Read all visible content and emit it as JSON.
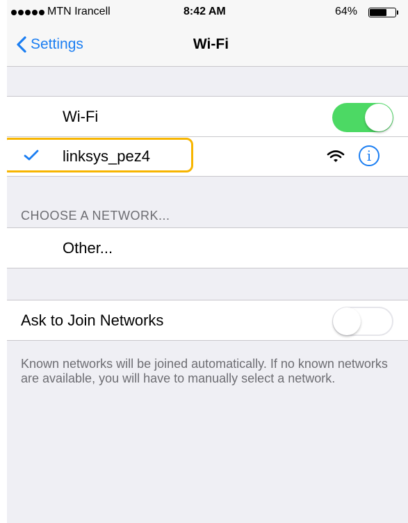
{
  "status_bar": {
    "carrier": "MTN Irancell",
    "time": "8:42 AM",
    "battery_percent": "64%",
    "battery_level": 0.64
  },
  "nav": {
    "back_label": "Settings",
    "title": "Wi-Fi"
  },
  "wifi": {
    "label": "Wi-Fi",
    "enabled": true
  },
  "connected_network": {
    "name": "linksys_pez4",
    "check_icon": "checkmark-icon",
    "signal_icon": "wifi-signal-icon",
    "info_icon": "info-icon",
    "info_glyph": "i"
  },
  "choose_network": {
    "header": "CHOOSE A NETWORK...",
    "other_label": "Other..."
  },
  "ask_to_join": {
    "label": "Ask to Join Networks",
    "enabled": false,
    "footer": "Known networks will be joined automatically. If no known networks are available, you will have to manually select a network."
  },
  "colors": {
    "accent": "#1b7ef2",
    "toggle_on": "#4cd964",
    "highlight": "#f7b500",
    "background": "#efeff4"
  }
}
